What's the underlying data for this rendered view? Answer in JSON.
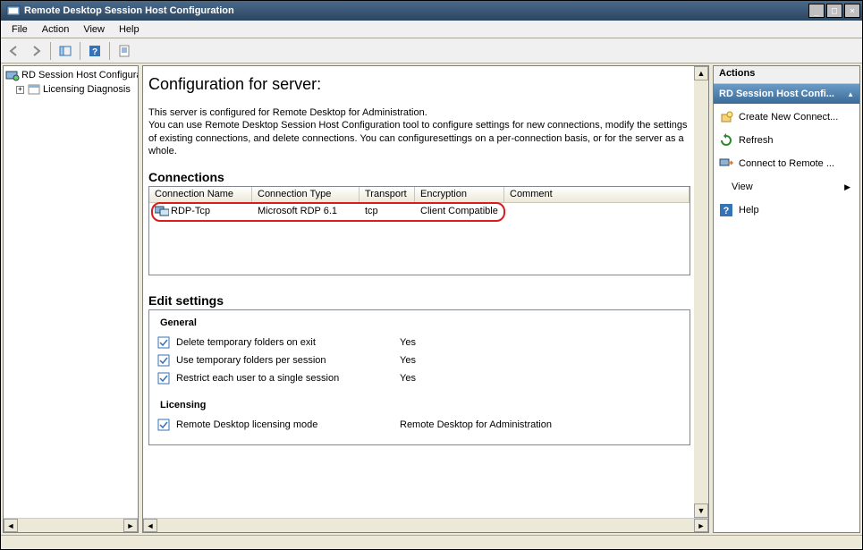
{
  "window": {
    "title": "Remote Desktop Session Host Configuration"
  },
  "menu": [
    "File",
    "Action",
    "View",
    "Help"
  ],
  "toolbar_icons": [
    "back",
    "forward",
    "|",
    "show-hide-tree",
    "|",
    "help",
    "|",
    "properties"
  ],
  "tree": {
    "root": "RD Session Host Configura",
    "children": [
      {
        "label": "Licensing Diagnosis"
      }
    ]
  },
  "main": {
    "title": "Configuration for server:",
    "desc_line1": "This server is configured for Remote Desktop for Administration.",
    "desc_line2": "You can use Remote Desktop Session Host Configuration tool to configure settings for new connections, modify the settings of existing connections, and delete connections. You can configuresettings on a per-connection basis, or for the server as a whole.",
    "connections_heading": "Connections",
    "conn_columns": [
      "Connection Name",
      "Connection Type",
      "Transport",
      "Encryption",
      "Comment"
    ],
    "conn_col_widths": [
      115,
      120,
      62,
      100,
      100
    ],
    "conn_rows": [
      {
        "icon": "connection",
        "cells": [
          "RDP-Tcp",
          "Microsoft RDP 6.1",
          "tcp",
          "Client Compatible",
          ""
        ]
      }
    ],
    "edit_heading": "Edit settings",
    "groups": [
      {
        "title": "General",
        "rows": [
          {
            "label": "Delete temporary folders on exit",
            "value": "Yes"
          },
          {
            "label": "Use temporary folders per session",
            "value": "Yes"
          },
          {
            "label": "Restrict each user to a single session",
            "value": "Yes"
          }
        ]
      },
      {
        "title": "Licensing",
        "rows": [
          {
            "label": "Remote Desktop licensing mode",
            "value": "Remote Desktop for Administration"
          }
        ]
      }
    ]
  },
  "actions": {
    "title": "Actions",
    "subtitle": "RD Session Host Confi...",
    "items": [
      {
        "icon": "new",
        "label": "Create New Connect..."
      },
      {
        "icon": "refresh",
        "label": "Refresh"
      },
      {
        "icon": "connect",
        "label": "Connect to Remote ..."
      },
      {
        "icon": "",
        "label": "View",
        "submenu": true
      },
      {
        "icon": "help",
        "label": "Help"
      }
    ]
  }
}
